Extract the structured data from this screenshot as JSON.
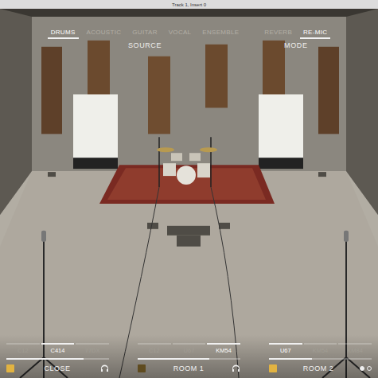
{
  "window": {
    "title": "Track 1, Insert 0"
  },
  "source": {
    "label": "SOURCE",
    "tabs": [
      {
        "label": "DRUMS",
        "selected": true
      },
      {
        "label": "ACOUSTIC",
        "selected": false
      },
      {
        "label": "GUITAR",
        "selected": false
      },
      {
        "label": "VOCAL",
        "selected": false
      },
      {
        "label": "ENSEMBLE",
        "selected": false
      }
    ]
  },
  "mode": {
    "label": "MODE",
    "tabs": [
      {
        "label": "REVERB",
        "selected": false
      },
      {
        "label": "RE-MIC",
        "selected": true
      }
    ]
  },
  "mic_slots": [
    {
      "name": "CLOSE",
      "enabled": true,
      "level": 0.75,
      "mics": [
        {
          "label": "C12",
          "selected": false
        },
        {
          "label": "C414",
          "selected": true
        },
        {
          "label": "77DX",
          "selected": false
        }
      ]
    },
    {
      "name": "ROOM 1",
      "enabled": false,
      "level": 0.7,
      "mics": [
        {
          "label": "C12",
          "selected": false
        },
        {
          "label": "U67",
          "selected": false
        },
        {
          "label": "KM54",
          "selected": true
        }
      ]
    },
    {
      "name": "ROOM 2",
      "enabled": true,
      "level": 0.42,
      "mics": [
        {
          "label": "U67",
          "selected": true
        },
        {
          "label": "KM54",
          "selected": false
        },
        {
          "label": "KM84",
          "selected": false
        }
      ]
    }
  ],
  "pager": [
    {
      "selected": true
    },
    {
      "selected": false
    }
  ]
}
